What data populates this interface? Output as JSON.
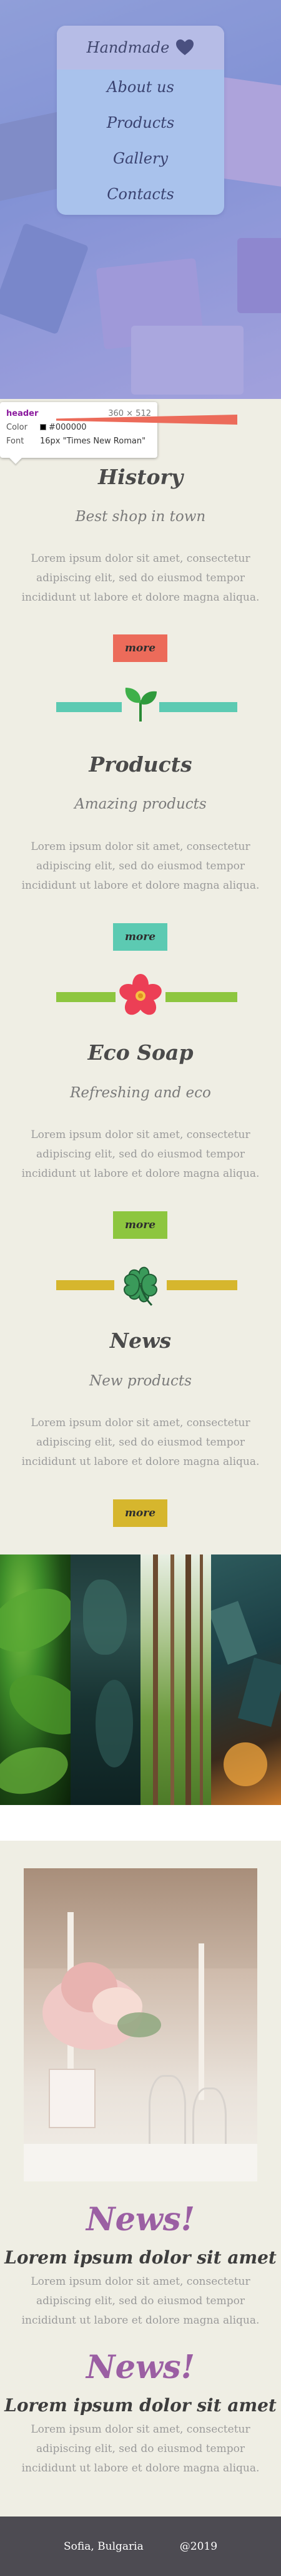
{
  "nav": {
    "brand": "Handmade",
    "items": [
      {
        "label": "About us"
      },
      {
        "label": "Products"
      },
      {
        "label": "Gallery"
      },
      {
        "label": "Contacts"
      }
    ]
  },
  "devtools": {
    "tag": "header",
    "size": "360 × 512",
    "color_key": "Color",
    "color_value": "#000000",
    "font_key": "Font",
    "font_value": "16px \"Times New Roman\""
  },
  "sections": [
    {
      "title": "History",
      "subtitle": "Best shop in town",
      "text": "Lorem ipsum dolor sit amet, consectetur adipiscing elit, sed do eiusmod tempor incididunt ut labore et dolore magna aliqua.",
      "button": "more",
      "accent": "#ec6b5a",
      "emblem": "none-icon"
    },
    {
      "title": "Products",
      "subtitle": "Amazing products",
      "text": "Lorem ipsum dolor sit amet, consectetur adipiscing elit, sed do eiusmod tempor incididunt ut labore et dolore magna aliqua.",
      "button": "more",
      "accent": "#5ccab2",
      "emblem": "leaf-sprout-icon"
    },
    {
      "title": "Eco Soap",
      "subtitle": "Refreshing and eco",
      "text": "Lorem ipsum dolor sit amet, consectetur adipiscing elit, sed do eiusmod tempor incididunt ut labore et dolore magna aliqua.",
      "button": "more",
      "accent": "#8dc63f",
      "emblem": "flower-icon"
    },
    {
      "title": "News",
      "subtitle": "New products",
      "text": "Lorem ipsum dolor sit amet, consectetur adipiscing elit, sed do eiusmod tempor incididunt ut labore et dolore magna aliqua.",
      "button": "more",
      "accent": "#d6b62d",
      "emblem": "four-leaf-clover-icon"
    }
  ],
  "news": [
    {
      "heading": "News!",
      "lead": "Lorem ipsum dolor sit amet",
      "text": "Lorem ipsum dolor sit amet, consectetur adipiscing elit, sed do eiusmod tempor incididunt ut labore et dolore magna aliqua."
    },
    {
      "heading": "News!",
      "lead": "Lorem ipsum dolor sit amet",
      "text": "Lorem ipsum dolor sit amet, consectetur adipiscing elit, sed do eiusmod tempor incididunt ut labore et dolore magna aliqua."
    }
  ],
  "footer": {
    "location": "Sofia, Bulgaria",
    "year": "@2019"
  },
  "colors": {
    "background": "#efeee4",
    "news_heading": "#9b5fa3",
    "footer": "#4d4b52",
    "menu": "#a9c2ec"
  }
}
